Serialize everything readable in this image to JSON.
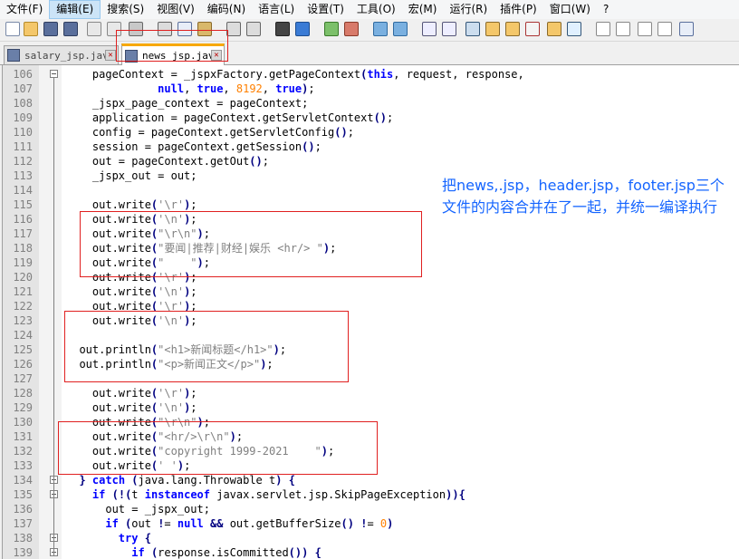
{
  "menubar": {
    "items": [
      "文件(F)",
      "编辑(E)",
      "搜索(S)",
      "视图(V)",
      "编码(N)",
      "语言(L)",
      "设置(T)",
      "工具(O)",
      "宏(M)",
      "运行(R)",
      "插件(P)",
      "窗口(W)",
      "?"
    ]
  },
  "tabs": [
    {
      "label": "salary_jsp.java",
      "active": false
    },
    {
      "label": "news_jsp.java",
      "active": true
    }
  ],
  "code_lines": [
    {
      "n": "106",
      "t": "    pageContext = _jspxFactory.getPageContext(this, request, response,"
    },
    {
      "n": "107",
      "t": "              null, true, 8192, true);"
    },
    {
      "n": "108",
      "t": "    _jspx_page_context = pageContext;"
    },
    {
      "n": "109",
      "t": "    application = pageContext.getServletContext();"
    },
    {
      "n": "110",
      "t": "    config = pageContext.getServletConfig();"
    },
    {
      "n": "111",
      "t": "    session = pageContext.getSession();"
    },
    {
      "n": "112",
      "t": "    out = pageContext.getOut();"
    },
    {
      "n": "113",
      "t": "    _jspx_out = out;"
    },
    {
      "n": "114",
      "t": ""
    },
    {
      "n": "115",
      "t": "    out.write('\\r');"
    },
    {
      "n": "116",
      "t": "    out.write('\\n');"
    },
    {
      "n": "117",
      "t": "    out.write(\"\\r\\n\");"
    },
    {
      "n": "118",
      "t": "    out.write(\"要闻|推荐|财经|娱乐 <hr/> \");"
    },
    {
      "n": "119",
      "t": "    out.write(\"    \");"
    },
    {
      "n": "120",
      "t": "    out.write('\\r');"
    },
    {
      "n": "121",
      "t": "    out.write('\\n');"
    },
    {
      "n": "122",
      "t": "    out.write('\\r');"
    },
    {
      "n": "123",
      "t": "    out.write('\\n');"
    },
    {
      "n": "124",
      "t": ""
    },
    {
      "n": "125",
      "t": "  out.println(\"<h1>新闻标题</h1>\");"
    },
    {
      "n": "126",
      "t": "  out.println(\"<p>新闻正文</p>\");"
    },
    {
      "n": "127",
      "t": ""
    },
    {
      "n": "128",
      "t": "    out.write('\\r');"
    },
    {
      "n": "129",
      "t": "    out.write('\\n');"
    },
    {
      "n": "130",
      "t": "    out.write(\"\\r\\n\");"
    },
    {
      "n": "131",
      "t": "    out.write(\"<hr/>\\r\\n\");"
    },
    {
      "n": "132",
      "t": "    out.write(\"copyright 1999-2021    \");"
    },
    {
      "n": "133",
      "t": "    out.write(' ');"
    },
    {
      "n": "134",
      "t": "  } catch (java.lang.Throwable t) {"
    },
    {
      "n": "135",
      "t": "    if (!(t instanceof javax.servlet.jsp.SkipPageException)){"
    },
    {
      "n": "136",
      "t": "      out = _jspx_out;"
    },
    {
      "n": "137",
      "t": "      if (out != null && out.getBufferSize() != 0)"
    },
    {
      "n": "138",
      "t": "        try {"
    },
    {
      "n": "139",
      "t": "          if (response.isCommitted()) {"
    }
  ],
  "annotation": {
    "text": "把news,.jsp，header.jsp，footer.jsp三个文件的内容合并在了一起，并统一编译执行",
    "color": "#1565ff"
  },
  "colors": {
    "keyword": "#0000ff",
    "string": "#808080",
    "number": "#ff8000",
    "highlight_box": "#e02020",
    "active_tab_accent": "#f7a800"
  }
}
